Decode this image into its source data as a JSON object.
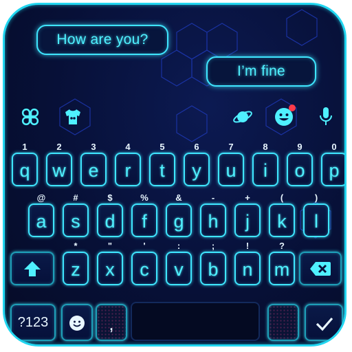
{
  "chat": {
    "incoming": "How are you?",
    "outgoing": "I’m fine"
  },
  "toolbar": {
    "icons": [
      "clover-icon",
      "tshirt-icon",
      "planet-icon",
      "emoji-icon",
      "microphone-icon"
    ],
    "notification_color": "#ff3b4a"
  },
  "keyboard": {
    "row1": [
      {
        "key": "q",
        "hint": "1"
      },
      {
        "key": "w",
        "hint": "2"
      },
      {
        "key": "e",
        "hint": "3"
      },
      {
        "key": "r",
        "hint": "4"
      },
      {
        "key": "t",
        "hint": "5"
      },
      {
        "key": "y",
        "hint": "6"
      },
      {
        "key": "u",
        "hint": "7"
      },
      {
        "key": "i",
        "hint": "8"
      },
      {
        "key": "o",
        "hint": "9"
      },
      {
        "key": "p",
        "hint": "0"
      }
    ],
    "row2": [
      {
        "key": "a",
        "hint": "@"
      },
      {
        "key": "s",
        "hint": "#"
      },
      {
        "key": "d",
        "hint": "$"
      },
      {
        "key": "f",
        "hint": "%"
      },
      {
        "key": "g",
        "hint": "&"
      },
      {
        "key": "h",
        "hint": "-"
      },
      {
        "key": "j",
        "hint": "+"
      },
      {
        "key": "k",
        "hint": "("
      },
      {
        "key": "l",
        "hint": ")"
      }
    ],
    "row3": [
      {
        "key": "z",
        "hint": "*"
      },
      {
        "key": "x",
        "hint": "\""
      },
      {
        "key": "c",
        "hint": "'"
      },
      {
        "key": "v",
        "hint": ":"
      },
      {
        "key": "b",
        "hint": ";"
      },
      {
        "key": "n",
        "hint": "!"
      },
      {
        "key": "m",
        "hint": "?"
      }
    ],
    "numbers_label": "?123",
    "comma_label": ",",
    "accent_color": "#3fe6ff"
  }
}
